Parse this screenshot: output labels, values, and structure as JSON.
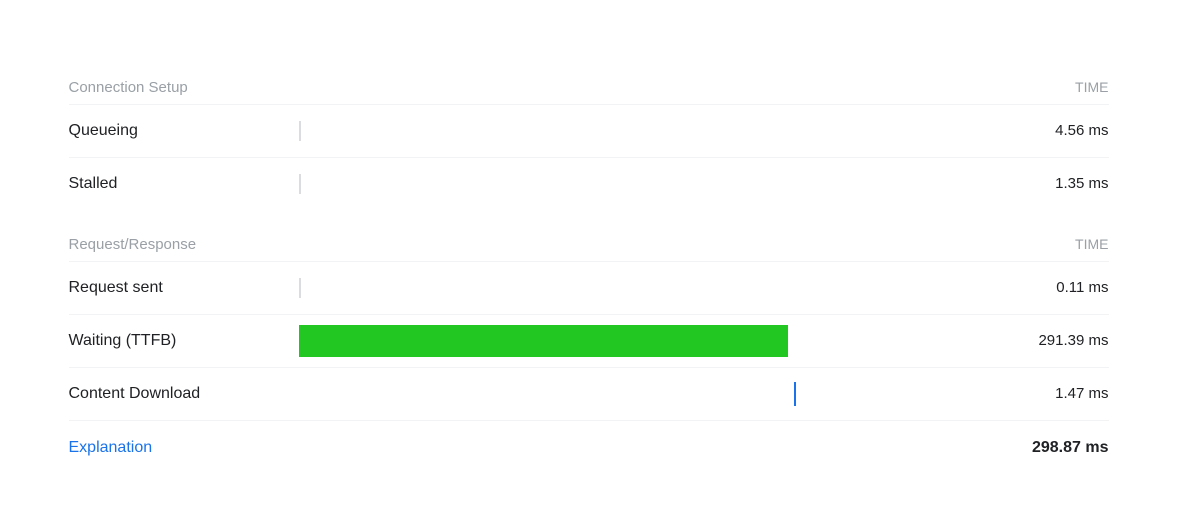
{
  "sections": [
    {
      "id": "connection-setup",
      "title": "Connection Setup",
      "time_label": "TIME",
      "rows": [
        {
          "label": "Queueing",
          "time": "4.56 ms",
          "bar_type": "thin-line",
          "bar_left_pct": 0,
          "bar_width_pct": 0
        },
        {
          "label": "Stalled",
          "time": "1.35 ms",
          "bar_type": "thin-line",
          "bar_left_pct": 0,
          "bar_width_pct": 0
        }
      ]
    },
    {
      "id": "request-response",
      "title": "Request/Response",
      "time_label": "TIME",
      "rows": [
        {
          "label": "Request sent",
          "time": "0.11 ms",
          "bar_type": "thin-line",
          "bar_left_pct": 0,
          "bar_width_pct": 0
        },
        {
          "label": "Waiting (TTFB)",
          "time": "291.39 ms",
          "bar_type": "green-bar",
          "bar_left_pct": 1,
          "bar_width_pct": 68
        },
        {
          "label": "Content Download",
          "time": "1.47 ms",
          "bar_type": "blue-line",
          "bar_left_pct": 69,
          "bar_width_pct": 0
        }
      ]
    }
  ],
  "footer": {
    "explanation_label": "Explanation",
    "total_time": "298.87 ms"
  }
}
